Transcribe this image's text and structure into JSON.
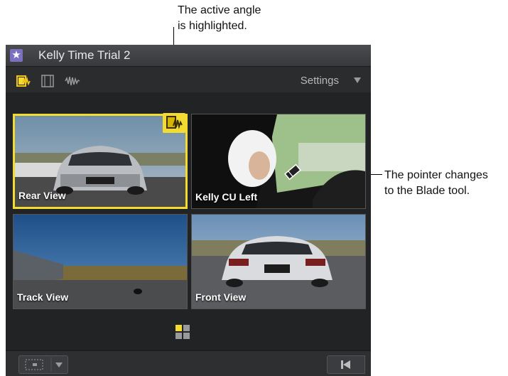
{
  "callouts": {
    "active_angle": [
      "The active angle",
      "is highlighted."
    ],
    "pointer": [
      "The pointer changes",
      "to the Blade tool."
    ]
  },
  "window": {
    "title": "Kelly Time Trial 2",
    "title_icon": "star-icon"
  },
  "toolbar": {
    "tools": [
      {
        "name": "video-and-audio-icon",
        "active": true
      },
      {
        "name": "video-only-icon",
        "active": false
      },
      {
        "name": "audio-only-icon",
        "active": false
      }
    ],
    "settings_label": "Settings",
    "settings_icon": "triangle-down-icon"
  },
  "angles": [
    {
      "label": "Rear View",
      "active": true
    },
    {
      "label": "Kelly CU Left",
      "active": false
    },
    {
      "label": "Track View",
      "active": false
    },
    {
      "label": "Front View",
      "active": false
    }
  ],
  "colors": {
    "active_highlight": "#f3db32",
    "panel_bg": "#222325"
  },
  "bottom": {
    "left_button_icon": "overlay-settings-icon",
    "right_button_icon": "go-to-start-icon"
  }
}
